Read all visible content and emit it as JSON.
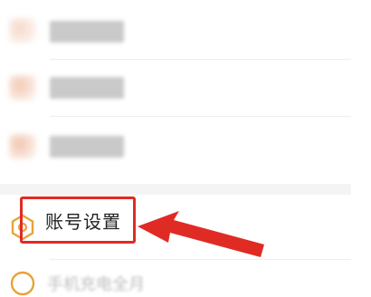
{
  "menu": {
    "account_settings_label": "账号设置",
    "bottom_partial_label": "手机充电全月",
    "colors": {
      "highlight": "#e02b24",
      "icon_accent": "#e8a23a",
      "label_text": "#222222"
    },
    "icons": {
      "account_settings": "hexagon-settings-icon"
    }
  }
}
